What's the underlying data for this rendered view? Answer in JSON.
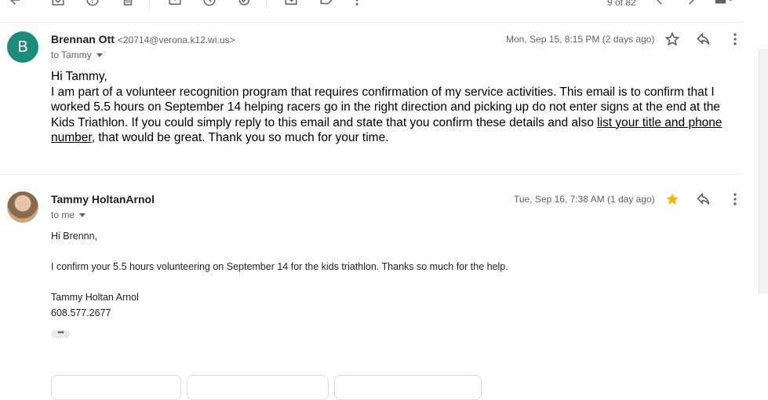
{
  "toolbar": {
    "pager": "9 of 82",
    "icons": [
      "back-arrow-icon",
      "archive-icon",
      "report-spam-icon",
      "delete-icon",
      "mark-unread-icon",
      "snooze-icon",
      "add-to-tasks-icon",
      "move-to-icon",
      "labels-icon",
      "more-vert-icon",
      "chevron-left-icon",
      "chevron-right-icon",
      "keyboard-icon"
    ]
  },
  "message1": {
    "sender": "Brennan Ott",
    "email": "<20714@verona.k12.wi.us>",
    "to": "to Tammy",
    "date": "Mon, Sep 15, 8:15 PM (2 days ago)",
    "avatar_letter": "B",
    "greeting": "Hi Tammy,",
    "body_main": "I am part of a volunteer recognition program that requires confirmation of my service activities. This email is to confirm that I worked 5.5 hours on September 14 helping racers go in the right direction and picking up do not enter signs at the end at the Kids Triathlon. If you could simply reply to this email and state that you confirm these details and also ",
    "body_underlined": "list your title and phone number",
    "body_end": ", that would be great. Thank you so much for your time.",
    "starred": false
  },
  "message2": {
    "sender": "Tammy HoltanArnol",
    "to": "to me",
    "date": "Tue, Sep 16, 7:38 AM (1 day ago)",
    "greeting": "Hi Brennn,",
    "body": "I confirm your 5.5 hours volunteering on September 14 for the kids triathlon. Thanks so much for the help.",
    "signature_name": "Tammy Holtan Arnol",
    "signature_phone": "608.577.2677",
    "starred": true
  },
  "colors": {
    "accent_avatar": "#1e8c78",
    "star_filled": "#f4b400"
  }
}
